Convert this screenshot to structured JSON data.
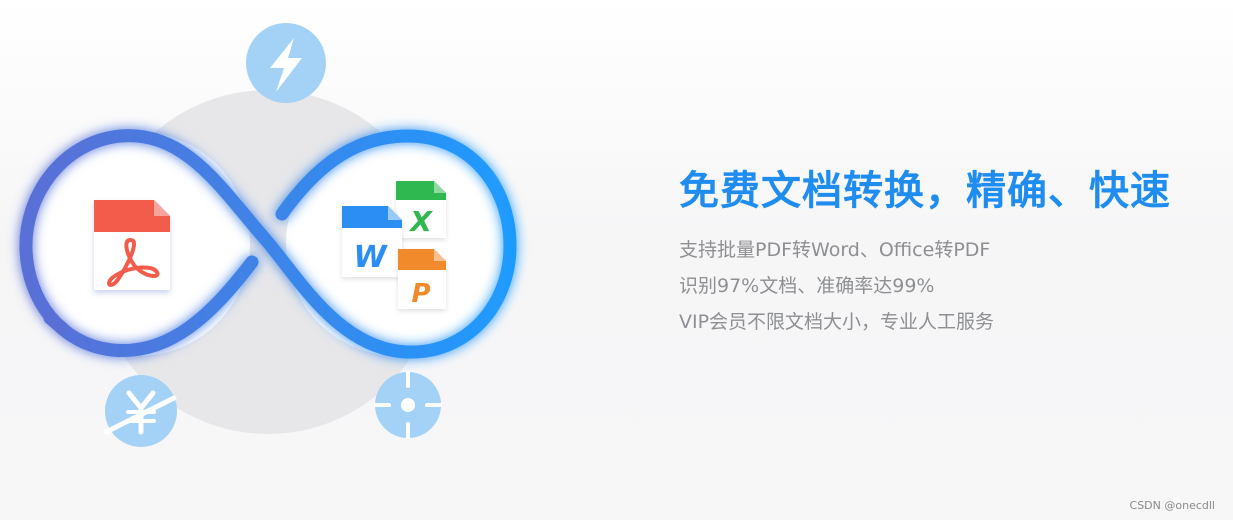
{
  "banner": {
    "headline": "免费文档转换，精确、快速",
    "features": [
      "支持批量PDF转Word、Office转PDF",
      "识别97%文档、准确率达99%",
      "VIP会员不限文档大小，专业人工服务"
    ]
  },
  "icons": {
    "lightning": "lightning-bolt-icon",
    "yen": "yen-crossed-icon",
    "target": "crosshair-target-icon",
    "pdf": "pdf-document-icon",
    "word": "word-document-icon",
    "excel": "excel-document-icon",
    "powerpoint": "powerpoint-document-icon"
  },
  "doc_letters": {
    "word": "W",
    "excel": "X",
    "powerpoint": "P"
  },
  "colors": {
    "headline": "#1f8cf0",
    "feature_text": "#8d8f93",
    "infinity_start": "#5a6fd6",
    "infinity_end": "#1f9bff",
    "pdf_red": "#f25b4c",
    "word_blue": "#2b8ef3",
    "excel_green": "#2fb84f",
    "ppt_orange": "#f08a2c",
    "badge_light_blue": "#9fd0f5"
  },
  "watermark": "CSDN @onecdll"
}
